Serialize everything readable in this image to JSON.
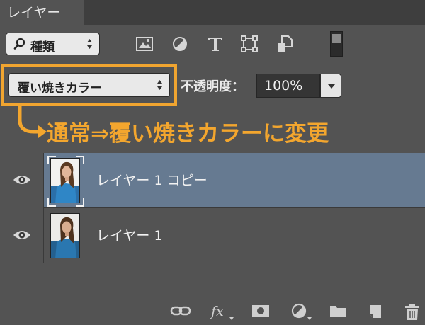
{
  "panel": {
    "tab_label": "レイヤー"
  },
  "filter": {
    "kind_label": "種類",
    "icons": [
      "pixel-layer-filter-icon",
      "adjustment-layer-filter-icon",
      "type-layer-filter-icon",
      "shape-layer-filter-icon",
      "smart-object-filter-icon"
    ]
  },
  "blend": {
    "mode_label": "覆い焼きカラー",
    "opacity_label": "不透明度：",
    "opacity_value": "100%"
  },
  "annotation": {
    "text": "通常⇒覆い焼きカラーに変更",
    "color": "#f3a62e"
  },
  "layers": [
    {
      "name": "レイヤー 1 コピー",
      "selected": true,
      "visible": true
    },
    {
      "name": "レイヤー 1",
      "selected": false,
      "visible": true
    }
  ],
  "colors": {
    "selected_row": "#667a91",
    "panel_bg": "#535353",
    "highlight": "#f1a530"
  },
  "bottom_bar_icons": [
    "link-layers-icon",
    "fx-icon",
    "layer-mask-icon",
    "adjustment-layer-icon",
    "new-group-icon",
    "new-layer-icon",
    "delete-icon"
  ]
}
